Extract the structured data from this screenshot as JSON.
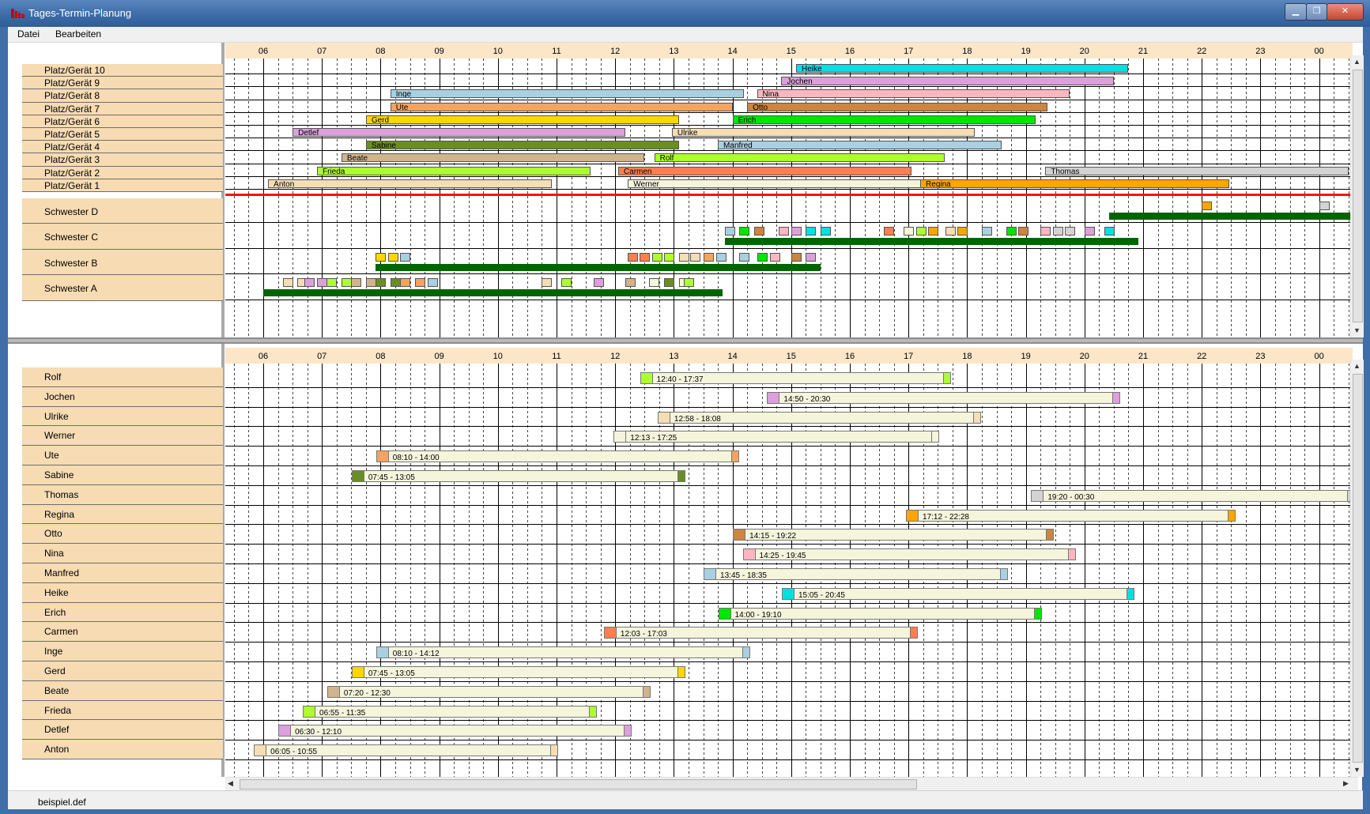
{
  "window": {
    "title": "Tages-Termin-Planung"
  },
  "menu": {
    "items": [
      "Datei",
      "Bearbeiten"
    ]
  },
  "hours": [
    "06",
    "07",
    "08",
    "09",
    "10",
    "11",
    "12",
    "13",
    "14",
    "15",
    "16",
    "17",
    "18",
    "19",
    "20",
    "21",
    "22",
    "23",
    "00"
  ],
  "top": {
    "places": [
      {
        "label": "Platz/Gerät 10",
        "bars": [
          {
            "name": "Heike",
            "start": "15:05",
            "end": "20:45",
            "color": "#00e0e0"
          }
        ]
      },
      {
        "label": "Platz/Gerät 9",
        "bars": [
          {
            "name": "Jochen",
            "start": "14:50",
            "end": "20:30",
            "color": "#dda0dd"
          }
        ]
      },
      {
        "label": "Platz/Gerät 8",
        "bars": [
          {
            "name": "Inge",
            "start": "08:10",
            "end": "14:12",
            "color": "#a8d0e0"
          },
          {
            "name": "Nina",
            "start": "14:25",
            "end": "19:45",
            "color": "#ffb6c1"
          }
        ]
      },
      {
        "label": "Platz/Gerät 7",
        "bars": [
          {
            "name": "Ute",
            "start": "08:10",
            "end": "14:00",
            "color": "#f4a460"
          },
          {
            "name": "Otto",
            "start": "14:15",
            "end": "19:22",
            "color": "#cd853f"
          }
        ]
      },
      {
        "label": "Platz/Gerät 6",
        "bars": [
          {
            "name": "Gerd",
            "start": "07:45",
            "end": "13:05",
            "color": "#ffd700"
          },
          {
            "name": "Erich",
            "start": "14:00",
            "end": "19:10",
            "color": "#00e600"
          }
        ]
      },
      {
        "label": "Platz/Gerät 5",
        "bars": [
          {
            "name": "Detlef",
            "start": "06:30",
            "end": "12:10",
            "color": "#dda0dd"
          },
          {
            "name": "Ulrike",
            "start": "12:58",
            "end": "18:08",
            "color": "#f5deb3"
          }
        ]
      },
      {
        "label": "Platz/Gerät 4",
        "bars": [
          {
            "name": "Sabine",
            "start": "07:45",
            "end": "13:05",
            "color": "#6b8e23"
          },
          {
            "name": "Manfred",
            "start": "13:45",
            "end": "18:35",
            "color": "#a8d0e0"
          }
        ]
      },
      {
        "label": "Platz/Gerät 3",
        "bars": [
          {
            "name": "Beate",
            "start": "07:20",
            "end": "12:30",
            "color": "#d2b48c"
          },
          {
            "name": "Rolf",
            "start": "12:40",
            "end": "17:37",
            "color": "#adff2f"
          }
        ]
      },
      {
        "label": "Platz/Gerät 2",
        "bars": [
          {
            "name": "Frieda",
            "start": "06:55",
            "end": "11:35",
            "color": "#adff2f"
          },
          {
            "name": "Carmen",
            "start": "12:03",
            "end": "17:03",
            "color": "#ff7f50"
          },
          {
            "name": "Thomas",
            "start": "19:20",
            "end": "00:30",
            "color": "#d3d3d3"
          }
        ]
      },
      {
        "label": "Platz/Gerät 1",
        "bars": [
          {
            "name": "Anton",
            "start": "06:05",
            "end": "10:55",
            "color": "#f5deb3"
          },
          {
            "name": "Werner",
            "start": "12:13",
            "end": "17:25",
            "color": "#f5f5dc"
          },
          {
            "name": "Regina",
            "start": "17:12",
            "end": "22:28",
            "color": "#ffa500"
          }
        ]
      }
    ],
    "nurses": [
      {
        "label": "Schwester D",
        "shift": [
          "20:25",
          "00:45"
        ],
        "blocks": [
          {
            "t": "22:00",
            "c": "#ffa500"
          },
          {
            "t": "00:00",
            "c": "#d3d3d3"
          }
        ]
      },
      {
        "label": "Schwester C",
        "shift": [
          "13:52",
          "20:55"
        ],
        "blocks": [
          {
            "t": "13:52",
            "c": "#a8d0e0"
          },
          {
            "t": "14:07",
            "c": "#00e600"
          },
          {
            "t": "14:22",
            "c": "#cd853f"
          },
          {
            "t": "14:47",
            "c": "#ffb6c1"
          },
          {
            "t": "15:00",
            "c": "#dda0dd"
          },
          {
            "t": "15:15",
            "c": "#00e0e0"
          },
          {
            "t": "15:30",
            "c": "#00e0e0"
          },
          {
            "t": "16:35",
            "c": "#ff7f50"
          },
          {
            "t": "16:55",
            "c": "#f5f5dc"
          },
          {
            "t": "17:08",
            "c": "#adff2f"
          },
          {
            "t": "17:20",
            "c": "#ffa500"
          },
          {
            "t": "17:38",
            "c": "#f5deb3"
          },
          {
            "t": "17:50",
            "c": "#ffa500"
          },
          {
            "t": "18:15",
            "c": "#a8d0e0"
          },
          {
            "t": "18:40",
            "c": "#00e600"
          },
          {
            "t": "18:52",
            "c": "#cd853f"
          },
          {
            "t": "19:15",
            "c": "#ffb6c1"
          },
          {
            "t": "19:28",
            "c": "#d3d3d3"
          },
          {
            "t": "19:40",
            "c": "#d3d3d3"
          },
          {
            "t": "20:00",
            "c": "#dda0dd"
          },
          {
            "t": "20:20",
            "c": "#00e0e0"
          }
        ]
      },
      {
        "label": "Schwester B",
        "shift": [
          "07:55",
          "15:30"
        ],
        "blocks": [
          {
            "t": "07:55",
            "c": "#ffd700"
          },
          {
            "t": "08:08",
            "c": "#ffd700"
          },
          {
            "t": "08:20",
            "c": "#a8d0e0"
          },
          {
            "t": "12:13",
            "c": "#ff7f50"
          },
          {
            "t": "12:25",
            "c": "#ff7f50"
          },
          {
            "t": "12:38",
            "c": "#adff2f"
          },
          {
            "t": "12:50",
            "c": "#adff2f"
          },
          {
            "t": "13:05",
            "c": "#f5deb3"
          },
          {
            "t": "13:17",
            "c": "#f5deb3"
          },
          {
            "t": "13:30",
            "c": "#f4a460"
          },
          {
            "t": "13:43",
            "c": "#a8d0e0"
          },
          {
            "t": "14:07",
            "c": "#a8d0e0"
          },
          {
            "t": "14:25",
            "c": "#00e600"
          },
          {
            "t": "14:38",
            "c": "#ffb6c1"
          },
          {
            "t": "15:00",
            "c": "#cd853f"
          },
          {
            "t": "15:15",
            "c": "#dda0dd"
          }
        ]
      },
      {
        "label": "Schwester A",
        "shift": [
          "06:00",
          "13:50"
        ],
        "blocks": [
          {
            "t": "06:20",
            "c": "#f5deb3"
          },
          {
            "t": "06:35",
            "c": "#f5deb3"
          },
          {
            "t": "06:42",
            "c": "#dda0dd"
          },
          {
            "t": "06:55",
            "c": "#dda0dd"
          },
          {
            "t": "07:05",
            "c": "#adff2f"
          },
          {
            "t": "07:20",
            "c": "#adff2f"
          },
          {
            "t": "07:30",
            "c": "#d2b48c"
          },
          {
            "t": "07:45",
            "c": "#d2b48c"
          },
          {
            "t": "07:55",
            "c": "#6b8e23"
          },
          {
            "t": "08:10",
            "c": "#6b8e23"
          },
          {
            "t": "08:20",
            "c": "#f4a460"
          },
          {
            "t": "08:35",
            "c": "#f4a460"
          },
          {
            "t": "08:48",
            "c": "#a8d0e0"
          },
          {
            "t": "10:45",
            "c": "#f5deb3"
          },
          {
            "t": "11:05",
            "c": "#adff2f"
          },
          {
            "t": "11:38",
            "c": "#dda0dd"
          },
          {
            "t": "12:10",
            "c": "#d2b48c"
          },
          {
            "t": "12:35",
            "c": "#f5f5dc"
          },
          {
            "t": "12:50",
            "c": "#6b8e23"
          },
          {
            "t": "13:05",
            "c": "#f5f5dc"
          },
          {
            "t": "13:10",
            "c": "#adff2f"
          }
        ]
      }
    ]
  },
  "bottom": {
    "persons": [
      {
        "label": "Rolf",
        "text": "12:40 - 17:37",
        "color": "#adff2f"
      },
      {
        "label": "Jochen",
        "text": "14:50 - 20:30",
        "color": "#dda0dd"
      },
      {
        "label": "Ulrike",
        "text": "12:58 - 18:08",
        "color": "#f5deb3"
      },
      {
        "label": "Werner",
        "text": "12:13 - 17:25",
        "color": "#f5f5dc"
      },
      {
        "label": "Ute",
        "text": "08:10 - 14:00",
        "color": "#f4a460"
      },
      {
        "label": "Sabine",
        "text": "07:45 - 13:05",
        "color": "#6b8e23"
      },
      {
        "label": "Thomas",
        "text": "19:20 - 00:30",
        "color": "#d3d3d3"
      },
      {
        "label": "Regina",
        "text": "17:12 - 22:28",
        "color": "#ffa500"
      },
      {
        "label": "Otto",
        "text": "14:15 - 19:22",
        "color": "#cd853f"
      },
      {
        "label": "Nina",
        "text": "14:25 - 19:45",
        "color": "#ffb6c1"
      },
      {
        "label": "Manfred",
        "text": "13:45 - 18:35",
        "color": "#a8d0e0"
      },
      {
        "label": "Heike",
        "text": "15:05 - 20:45",
        "color": "#00e0e0"
      },
      {
        "label": "Erich",
        "text": "14:00 - 19:10",
        "color": "#00e600"
      },
      {
        "label": "Carmen",
        "text": "12:03 - 17:03",
        "color": "#ff7f50"
      },
      {
        "label": "Inge",
        "text": "08:10 - 14:12",
        "color": "#a8d0e0"
      },
      {
        "label": "Gerd",
        "text": "07:45 - 13:05",
        "color": "#ffd700"
      },
      {
        "label": "Beate",
        "text": "07:20 - 12:30",
        "color": "#d2b48c"
      },
      {
        "label": "Frieda",
        "text": "06:55 - 11:35",
        "color": "#adff2f"
      },
      {
        "label": "Detlef",
        "text": "06:30 - 12:10",
        "color": "#dda0dd"
      },
      {
        "label": "Anton",
        "text": "06:05 - 10:55",
        "color": "#f5deb3"
      }
    ]
  },
  "status": {
    "text": "beispiel.def"
  }
}
